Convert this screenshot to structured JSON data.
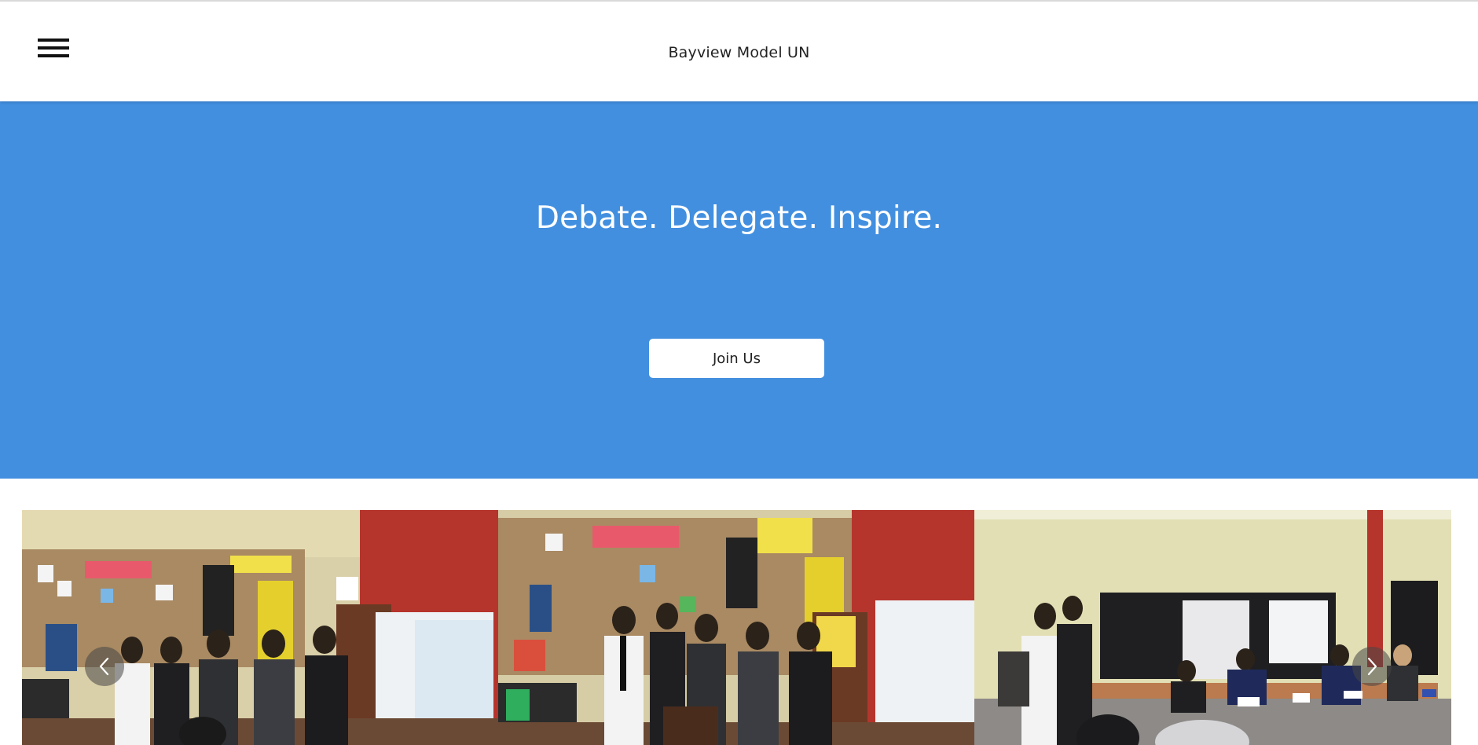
{
  "header": {
    "site_title": "Bayview Model UN",
    "menu_icon": "hamburger-menu-icon"
  },
  "hero": {
    "background_color": "#428fe0",
    "tagline": "Debate. Delegate. Inspire.",
    "cta_label": "Join Us"
  },
  "carousel": {
    "slides": [
      {
        "scene": "delegates standing in library"
      },
      {
        "scene": "delegates presenting at podium"
      },
      {
        "scene": "committee session at tables"
      }
    ],
    "prev_icon": "chevron-left-icon",
    "next_icon": "chevron-right-icon"
  }
}
